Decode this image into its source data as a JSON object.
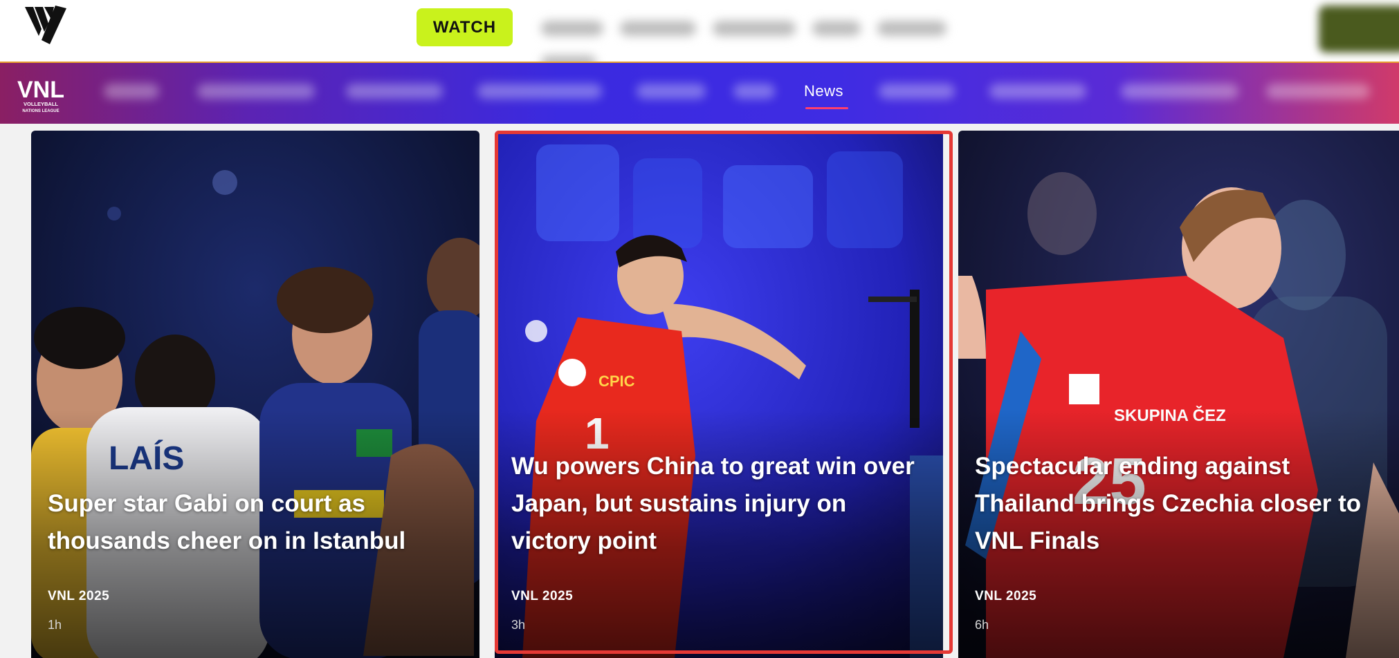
{
  "topbar": {
    "logo_icon": "volleyball-world-logo-icon",
    "watch_label": "WATCH",
    "watch_color": "#c9f21c"
  },
  "navbar": {
    "logo_text": "VNL",
    "logo_subtext": "VOLLEYBALL NATIONS LEAGUE",
    "active_item": "News",
    "accent_color": "#ff3f6c"
  },
  "cards": [
    {
      "title": "Super star Gabi on court as thousands cheer on in Istanbul",
      "tag": "VNL 2025",
      "time": "1h"
    },
    {
      "title": "Wu powers China to great win over Japan, but sustains injury on victory point",
      "tag": "VNL 2025",
      "time": "3h",
      "selected": true
    },
    {
      "title": "Spectacular ending against Thailand brings Czechia closer to VNL Finals",
      "tag": "VNL 2025",
      "time": "6h"
    }
  ],
  "highlight_color": "#e53935"
}
